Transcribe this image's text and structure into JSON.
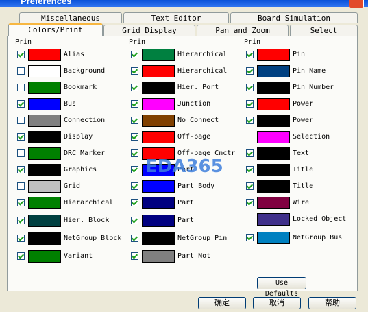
{
  "window": {
    "title": "Preferences"
  },
  "tabs_back": [
    "Miscellaneous",
    "Text Editor",
    "Board Simulation"
  ],
  "tabs_front": [
    "Colors/Print",
    "Grid Display",
    "Pan and Zoom",
    "Select"
  ],
  "column_header": "Prin",
  "col1": [
    {
      "label": "Alias",
      "color": "#ff0000",
      "checked": true
    },
    {
      "label": "Background",
      "color": "#ffffff",
      "checked": false
    },
    {
      "label": "Bookmark",
      "color": "#008000",
      "checked": false
    },
    {
      "label": "Bus",
      "color": "#0000ff",
      "checked": true
    },
    {
      "label": "Connection",
      "color": "#808080",
      "checked": false
    },
    {
      "label": "Display",
      "color": "#000000",
      "checked": true
    },
    {
      "label": "DRC Marker",
      "color": "#008000",
      "checked": false
    },
    {
      "label": "Graphics",
      "color": "#000000",
      "checked": true
    },
    {
      "label": "Grid",
      "color": "#c0c0c0",
      "checked": false
    },
    {
      "label": "Hierarchical",
      "color": "#008000",
      "checked": true
    },
    {
      "label": "Hier. Block",
      "color": "#004040",
      "checked": true
    },
    {
      "label": "NetGroup Block",
      "color": "#000000",
      "checked": true
    },
    {
      "label": "Variant",
      "color": "#008000",
      "checked": true
    }
  ],
  "col2": [
    {
      "label": "Hierarchical",
      "color": "#008040",
      "checked": true
    },
    {
      "label": "Hierarchical",
      "color": "#ff0000",
      "checked": true
    },
    {
      "label": "Hier. Port",
      "color": "#000000",
      "checked": true
    },
    {
      "label": "Junction",
      "color": "#ff00ff",
      "checked": true
    },
    {
      "label": "No Connect",
      "color": "#804000",
      "checked": true
    },
    {
      "label": "Off-page",
      "color": "#ff0000",
      "checked": true
    },
    {
      "label": "Off-page Cnctr",
      "color": "#ff0000",
      "checked": true
    },
    {
      "label": "Part",
      "color": "#0000ff",
      "checked": true
    },
    {
      "label": "Part Body",
      "color": "#0000ff",
      "checked": true
    },
    {
      "label": "Part",
      "color": "#000080",
      "checked": true
    },
    {
      "label": "Part",
      "color": "#000080",
      "checked": true
    },
    {
      "label": "NetGroup Pin",
      "color": "#000000",
      "checked": true
    },
    {
      "label": "Part Not",
      "color": "#808080",
      "checked": true
    }
  ],
  "col3": [
    {
      "label": "Pin",
      "color": "#ff0000",
      "checked": true
    },
    {
      "label": "Pin Name",
      "color": "#004080",
      "checked": true
    },
    {
      "label": "Pin Number",
      "color": "#000000",
      "checked": true
    },
    {
      "label": "Power",
      "color": "#ff0000",
      "checked": true
    },
    {
      "label": "Power",
      "color": "#000000",
      "checked": true
    },
    {
      "label": "Selection",
      "color": "#ff00ff",
      "checked": null
    },
    {
      "label": "Text",
      "color": "#000000",
      "checked": true
    },
    {
      "label": "Title",
      "color": "#000000",
      "checked": true
    },
    {
      "label": "Title",
      "color": "#000000",
      "checked": true
    },
    {
      "label": "Wire",
      "color": "#800040",
      "checked": true
    },
    {
      "label": "Locked Object",
      "color": "#40308a",
      "checked": null
    },
    {
      "label": "NetGroup Bus",
      "color": "#0080c0",
      "checked": true
    }
  ],
  "use_defaults": "Use Defaults",
  "buttons": {
    "ok": "确定",
    "cancel": "取消",
    "help": "帮助"
  },
  "watermark": "EDA365"
}
